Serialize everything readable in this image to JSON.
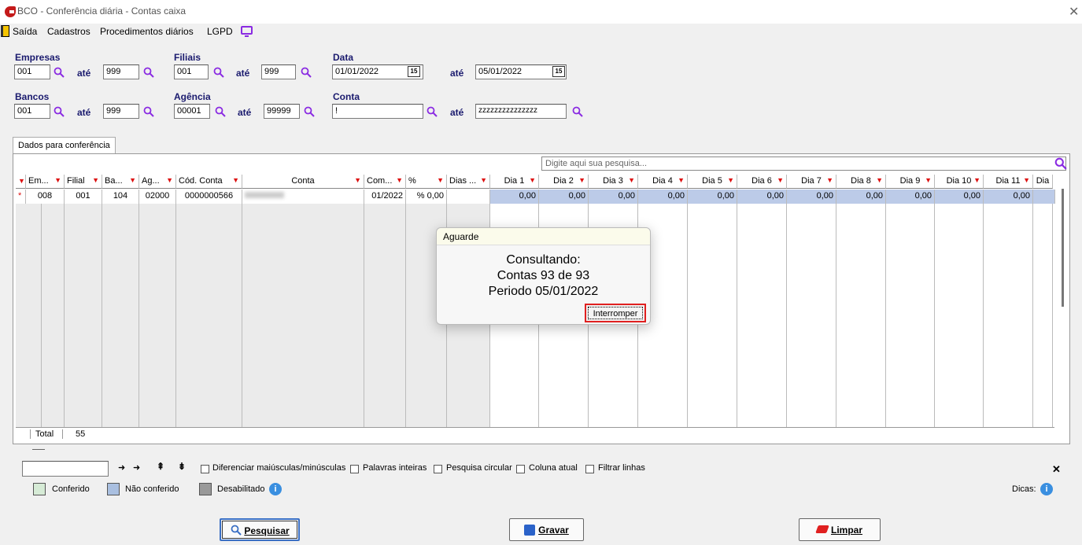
{
  "window": {
    "title": "BCO - Conferência diária - Contas caixa",
    "close": "✕"
  },
  "menu": [
    "Saída",
    "Cadastros",
    "Procedimentos diários",
    "LGPD"
  ],
  "filters": {
    "empresas": {
      "label": "Empresas",
      "from": "001",
      "to": "999"
    },
    "filiais": {
      "label": "Filiais",
      "from": "001",
      "to": "999"
    },
    "data": {
      "label": "Data",
      "from": "01/01/2022",
      "to": "05/01/2022"
    },
    "bancos": {
      "label": "Bancos",
      "from": "001",
      "to": "999"
    },
    "agencia": {
      "label": "Agência",
      "from": "00001",
      "to": "99999"
    },
    "conta": {
      "label": "Conta",
      "from": "!",
      "to": "zzzzzzzzzzzzzzz"
    },
    "ate": "até",
    "cal_icon": "15"
  },
  "tab": "Dados para conferência",
  "search_placeholder": "Digite aqui sua pesquisa...",
  "grid": {
    "headers": [
      "Em...",
      "Filial",
      "Ba...",
      "Ag...",
      "Cód. Conta",
      "Conta",
      "Com...",
      "%",
      "Dias ...",
      "Dia 1",
      "Dia 2",
      "Dia 3",
      "Dia 4",
      "Dia 5",
      "Dia 6",
      "Dia 7",
      "Dia 8",
      "Dia 9",
      "Dia 10",
      "Dia 11",
      "Dia"
    ],
    "row": [
      "008",
      "001",
      "104",
      "02000",
      "0000000566",
      "",
      "01/2022",
      "% 0,00",
      "",
      "0,00",
      "0,00",
      "0,00",
      "0,00",
      "0,00",
      "0,00",
      "0,00",
      "0,00",
      "0,00",
      "0,00",
      "0,00"
    ],
    "row_marker": "*",
    "total_label": "Total",
    "total_value": "55"
  },
  "dialog": {
    "title": "Aguarde",
    "line1": "Consultando:",
    "line2": "Contas 93 de 93",
    "line3": "Periodo 05/01/2022",
    "button": "Interromper"
  },
  "find_options": [
    "Diferenciar maiúsculas/minúsculas",
    "Palavras inteiras",
    "Pesquisa circular",
    "Coluna atual",
    "Filtrar linhas"
  ],
  "legend": {
    "conferido": "Conferido",
    "nao_conferido": "Não conferido",
    "desabilitado": "Desabilitado",
    "dicas": "Dicas:"
  },
  "buttons": {
    "pesquisar": "Pesquisar",
    "gravar": "Gravar",
    "limpar": "Limpar"
  },
  "colors": {
    "accent": "#8a2be2",
    "filter": "#d11111",
    "row_blue": "#bccbe8",
    "highlight": "#e02020"
  }
}
